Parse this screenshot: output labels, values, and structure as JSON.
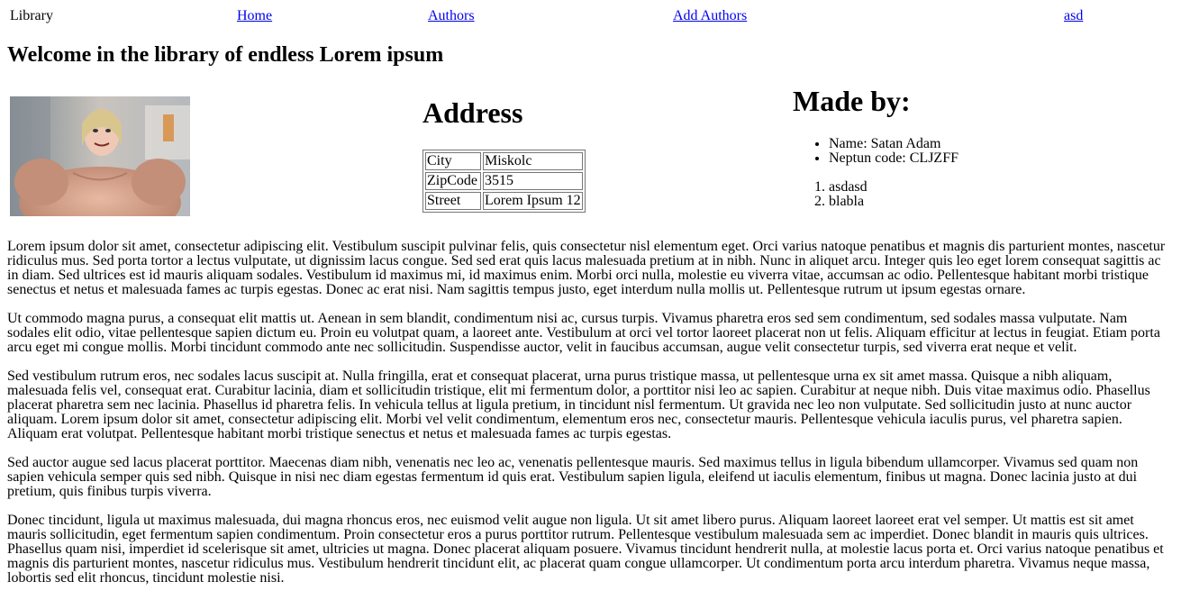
{
  "nav": {
    "brand": "Library",
    "links": [
      "Home",
      "Authors",
      "Add Authors",
      "asd"
    ]
  },
  "page_title": "Welcome in the library of endless Lorem ipsum",
  "address": {
    "title": "Address",
    "rows": [
      {
        "key": "City",
        "value": "Miskolc"
      },
      {
        "key": "ZipCode",
        "value": "3515"
      },
      {
        "key": "Street",
        "value": "Lorem Ipsum 12"
      }
    ]
  },
  "made_by": {
    "title": "Made by:",
    "bullets": [
      "Name: Satan Adam",
      "Neptun code: CLJZFF"
    ],
    "numbered": [
      "asdasd",
      "blabla"
    ]
  },
  "paragraphs": [
    "Lorem ipsum dolor sit amet, consectetur adipiscing elit. Vestibulum suscipit pulvinar felis, quis consectetur nisl elementum eget. Orci varius natoque penatibus et magnis dis parturient montes, nascetur ridiculus mus. Sed porta tortor a lectus vulputate, ut dignissim lacus congue. Sed sed erat quis lacus malesuada pretium at in nibh. Nunc in aliquet arcu. Integer quis leo eget lorem consequat sagittis ac in diam. Sed ultrices est id mauris aliquam sodales. Vestibulum id maximus mi, id maximus enim. Morbi orci nulla, molestie eu viverra vitae, accumsan ac odio. Pellentesque habitant morbi tristique senectus et netus et malesuada fames ac turpis egestas. Donec ac erat nisi. Nam sagittis tempus justo, eget interdum nulla mollis ut. Pellentesque rutrum ut ipsum egestas ornare.",
    "Ut commodo magna purus, a consequat elit mattis ut. Aenean in sem blandit, condimentum nisi ac, cursus turpis. Vivamus pharetra eros sed sem condimentum, sed sodales massa vulputate. Nam sodales elit odio, vitae pellentesque sapien dictum eu. Proin eu volutpat quam, a laoreet ante. Vestibulum at orci vel tortor laoreet placerat non ut felis. Aliquam efficitur at lectus in feugiat. Etiam porta arcu eget mi congue mollis. Morbi tincidunt commodo ante nec sollicitudin. Suspendisse auctor, velit in faucibus accumsan, augue velit consectetur turpis, sed viverra erat neque et velit.",
    "Sed vestibulum rutrum eros, nec sodales lacus suscipit at. Nulla fringilla, erat et consequat placerat, urna purus tristique massa, ut pellentesque urna ex sit amet massa. Quisque a nibh aliquam, malesuada felis vel, consequat erat. Curabitur lacinia, diam et sollicitudin tristique, elit mi fermentum dolor, a porttitor nisi leo ac sapien. Curabitur at neque nibh. Duis vitae maximus odio. Phasellus placerat pharetra sem nec lacinia. Phasellus id pharetra felis. In vehicula tellus at ligula pretium, in tincidunt nisl fermentum. Ut gravida nec leo non vulputate. Sed sollicitudin justo at nunc auctor aliquam. Lorem ipsum dolor sit amet, consectetur adipiscing elit. Morbi vel velit condimentum, elementum eros nec, consectetur mauris. Pellentesque vehicula iaculis purus, vel pharetra sapien. Aliquam erat volutpat. Pellentesque habitant morbi tristique senectus et netus et malesuada fames ac turpis egestas.",
    "Sed auctor augue sed lacus placerat porttitor. Maecenas diam nibh, venenatis nec leo ac, venenatis pellentesque mauris. Sed maximus tellus in ligula bibendum ullamcorper. Vivamus sed quam non sapien vehicula semper quis sed nibh. Quisque in nisi nec diam egestas fermentum id quis erat. Vestibulum sapien ligula, eleifend ut iaculis elementum, finibus ut magna. Donec lacinia justo at dui pretium, quis finibus turpis viverra.",
    "Donec tincidunt, ligula ut maximus malesuada, dui magna rhoncus eros, nec euismod velit augue non ligula. Ut sit amet libero purus. Aliquam laoreet laoreet erat vel semper. Ut mattis est sit amet mauris sollicitudin, eget fermentum sapien condimentum. Proin consectetur eros a purus porttitor rutrum. Pellentesque vestibulum malesuada sem ac imperdiet. Donec blandit in mauris quis ultrices. Phasellus quam nisi, imperdiet id scelerisque sit amet, ultricies ut magna. Donec placerat aliquam posuere. Vivamus tincidunt hendrerit nulla, at molestie lacus porta et. Orci varius natoque penatibus et magnis dis parturient montes, nascetur ridiculus mus. Vestibulum hendrerit tincidunt elit, ac placerat quam congue ullamcorper. Ut condimentum porta arcu interdum pharetra. Vivamus neque massa, lobortis sed elit rhoncus, tincidunt molestie nisi."
  ],
  "colors": {
    "link": "#0000ee",
    "text": "#000000",
    "background": "#ffffff"
  }
}
